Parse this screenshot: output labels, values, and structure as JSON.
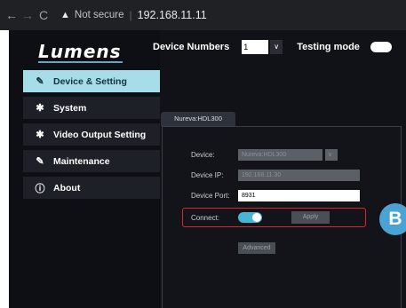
{
  "browser": {
    "back_icon": "←",
    "forward_icon": "→",
    "reload_icon": "C",
    "warning_icon": "▲",
    "security_label": "Not secure",
    "separator": "|",
    "url": "192.168.11.11"
  },
  "app": {
    "logo": "Lumens",
    "sidebar": {
      "items": [
        {
          "icon": "wrench-icon",
          "glyph": "✎",
          "label": "Device & Setting"
        },
        {
          "icon": "gear-icon",
          "glyph": "✱",
          "label": "System"
        },
        {
          "icon": "gear-icon",
          "glyph": "✱",
          "label": "Video Output Setting"
        },
        {
          "icon": "wrench-icon",
          "glyph": "✎",
          "label": "Maintenance"
        },
        {
          "icon": "info-icon",
          "glyph": "ⓘ",
          "label": "About"
        }
      ],
      "active_index": 0
    },
    "header": {
      "device_numbers_label": "Device Numbers",
      "device_numbers_value": "1",
      "select_arrow": "∨",
      "testing_mode_label": "Testing mode"
    },
    "tab_label": "Nureva:HDL300",
    "form": {
      "device_label": "Device:",
      "device_value": "Nureva:HDL300",
      "device_arrow": "∨",
      "ip_label": "Device IP:",
      "ip_value": "192.168.11.30",
      "port_label": "Device Port:",
      "port_value": "8931",
      "connect_label": "Connect:",
      "connect_on": true,
      "apply_label": "Apply",
      "advanced_label": "Advanced"
    },
    "callout": "B",
    "colors": {
      "active_menu_bg": "#a7dde8",
      "toggle_on": "#46b6d4",
      "highlight_border": "#d7262c",
      "callout_bg": "#4aa3d2"
    }
  }
}
